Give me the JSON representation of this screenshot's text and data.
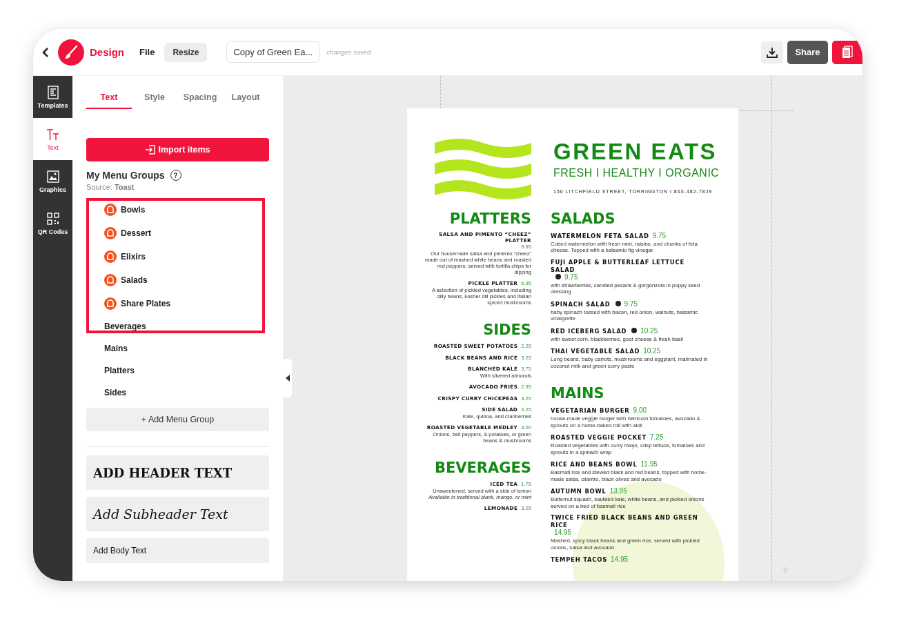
{
  "app": {
    "name": "Design",
    "file_menu": "File",
    "resize_button": "Resize",
    "document_title": "Copy of Green Ea...",
    "save_status": "changes saved",
    "share_button": "Share"
  },
  "rail": [
    {
      "kind": "templates",
      "label": "Templates",
      "selected": false
    },
    {
      "kind": "text",
      "label": "Text",
      "selected": true
    },
    {
      "kind": "graphics",
      "label": "Graphics",
      "selected": false
    },
    {
      "kind": "qr",
      "label": "QR Codes",
      "selected": false
    }
  ],
  "panel_tabs": [
    {
      "label": "Text",
      "selected": true
    },
    {
      "label": "Style",
      "selected": false
    },
    {
      "label": "Spacing",
      "selected": false
    },
    {
      "label": "Layout",
      "selected": false
    }
  ],
  "import_button": "Import items",
  "groups_title": "My Menu Groups",
  "help": "?",
  "source": "Source: **Toast**",
  "menu_groups": [
    {
      "label": "Bowls",
      "linked": true
    },
    {
      "label": "Dessert",
      "linked": true
    },
    {
      "label": "Elixirs",
      "linked": true
    },
    {
      "label": "Salads",
      "linked": true
    },
    {
      "label": "Share Plates",
      "linked": true
    },
    {
      "label": "Beverages",
      "linked": false
    },
    {
      "label": "Mains",
      "linked": false
    },
    {
      "label": "Platters",
      "linked": false
    },
    {
      "label": "Sides",
      "linked": false
    }
  ],
  "add_group_button": "+ Add Menu Group",
  "text_presets": [
    {
      "kind": "header",
      "label": "ADD HEADER TEXT"
    },
    {
      "kind": "subheader",
      "label": "Add Subheader Text"
    },
    {
      "kind": "body",
      "label": "Add Body Text"
    }
  ],
  "menu": {
    "title": "GREEN EATS",
    "tagline": "FRESH I HEALTHY I ORGANIC",
    "address": "156 LITCHFIELD STREET, TORRINGTON I 860-482-7829",
    "columns": [
      {
        "sections": [
          {
            "heading": "PLATTERS",
            "items": [
              {
                "name": "SALSA AND PIMENTO “CHEEZ” PLATTER",
                "price": "9.95",
                "badge": false,
                "description": "Our housemade salsa and pimento “cheez” made out of mashed white beans and roasted red peppers, served with tortilla chips for dipping"
              },
              {
                "name": "PICKLE PLATTER",
                "price": "6.95",
                "badge": false,
                "description": "A selection of pickled vegetables, including dilly beans, kosher dill pickles and Italian spiced mushrooms"
              }
            ]
          },
          {
            "heading": "SIDES",
            "items": [
              {
                "name": "ROASTED SWEET POTATOES",
                "price": "2.25",
                "badge": false
              },
              {
                "name": "BLACK BEANS AND RICE",
                "price": "3.25",
                "badge": false
              },
              {
                "name": "BLANCHED KALE",
                "price": "3.75",
                "badge": false,
                "description": "With slivered almonds"
              },
              {
                "name": "AVOCADO FRIES",
                "price": "2.95",
                "badge": false
              },
              {
                "name": "CRISPY CURRY CHICKPEAS",
                "price": "3.25",
                "badge": false
              },
              {
                "name": "SIDE SALAD",
                "price": "4.25",
                "badge": false,
                "description": "Kale, quinoa, and cranberries"
              },
              {
                "name": "ROASTED VEGETABLE MEDLEY",
                "price": "3.00",
                "badge": false,
                "description": "Onions, bell peppers, & potatoes, or green beans & mushrooms"
              }
            ]
          },
          {
            "heading": "BEVERAGES",
            "items": [
              {
                "name": "ICED TEA",
                "price": "1.75",
                "badge": false,
                "description": "Unsweetened, served with a side of lemon",
                "note": "Available in traditional blank, mango, or mint"
              },
              {
                "name": "LEMONADE",
                "price": "3.25",
                "badge": false
              }
            ]
          }
        ]
      },
      {
        "sections": [
          {
            "heading": "SALADS",
            "items": [
              {
                "name": "WATERMELON FETA SALAD",
                "price": "9.75",
                "badge": false,
                "description": "Cubed watermelon with fresh mint, raisins, and chunks of feta cheese. Topped with a balsamic fig vinegar"
              },
              {
                "name": "FUJI APPLE & BUTTERLEAF LETTUCE SALAD",
                "price": "9.75",
                "badge": true,
                "description": "with strawberries, candied pecans & gorgonzola in poppy seed dressing"
              },
              {
                "name": "SPINACH SALAD",
                "price": "9.75",
                "badge": true,
                "description": "baby spinach tossed with bacon, red onion, walnuts, balsamic vinaigrette"
              },
              {
                "name": "RED ICEBERG SALAD",
                "price": "10.25",
                "badge": true,
                "description": "with sweet corn, blackberries, goat cheese & fresh basil"
              },
              {
                "name": "THAI VEGETABLE SALAD",
                "price": "10.25",
                "badge": false,
                "description": "Long beans, baby carrots, mushrooms and eggplant, marinated in coconut milk and green curry paste"
              }
            ]
          },
          {
            "heading": "MAINS",
            "items": [
              {
                "name": "VEGETARIAN BURGER",
                "price": "9.00",
                "badge": false,
                "description": "house-made veggie burger with heirloom tomatoes, avocado & sprouts on a home-baked roll with aioli"
              },
              {
                "name": "ROASTED VEGGIE POCKET",
                "price": "7.25",
                "badge": false,
                "description": "Roasted vegetables with curry mayo, crisp lettuce, tomatoes and sprouts in a spinach wrap"
              },
              {
                "name": "RICE AND BEANS BOWL",
                "price": "11.95",
                "badge": false,
                "description": "Basmati rice and stewed black and red beans, topped with home-made salsa, cilantro, black olives and avocado"
              },
              {
                "name": "AUTUMN BOWL",
                "price": "13.95",
                "badge": false,
                "description": "Butternut squash, sautéed kale, white beans, and pickled onions served on a bed of basmati rice"
              },
              {
                "name": "TWICE FRIED BLACK BEANS AND GREEN RICE",
                "price": "14.95",
                "badge": false,
                "description": "Mashed, spicy black beans and green rice, served with pickled onions, salsa and avocado"
              },
              {
                "name": "TEMPEH TACOS",
                "price": "14.95",
                "badge": false
              }
            ]
          }
        ]
      }
    ]
  }
}
